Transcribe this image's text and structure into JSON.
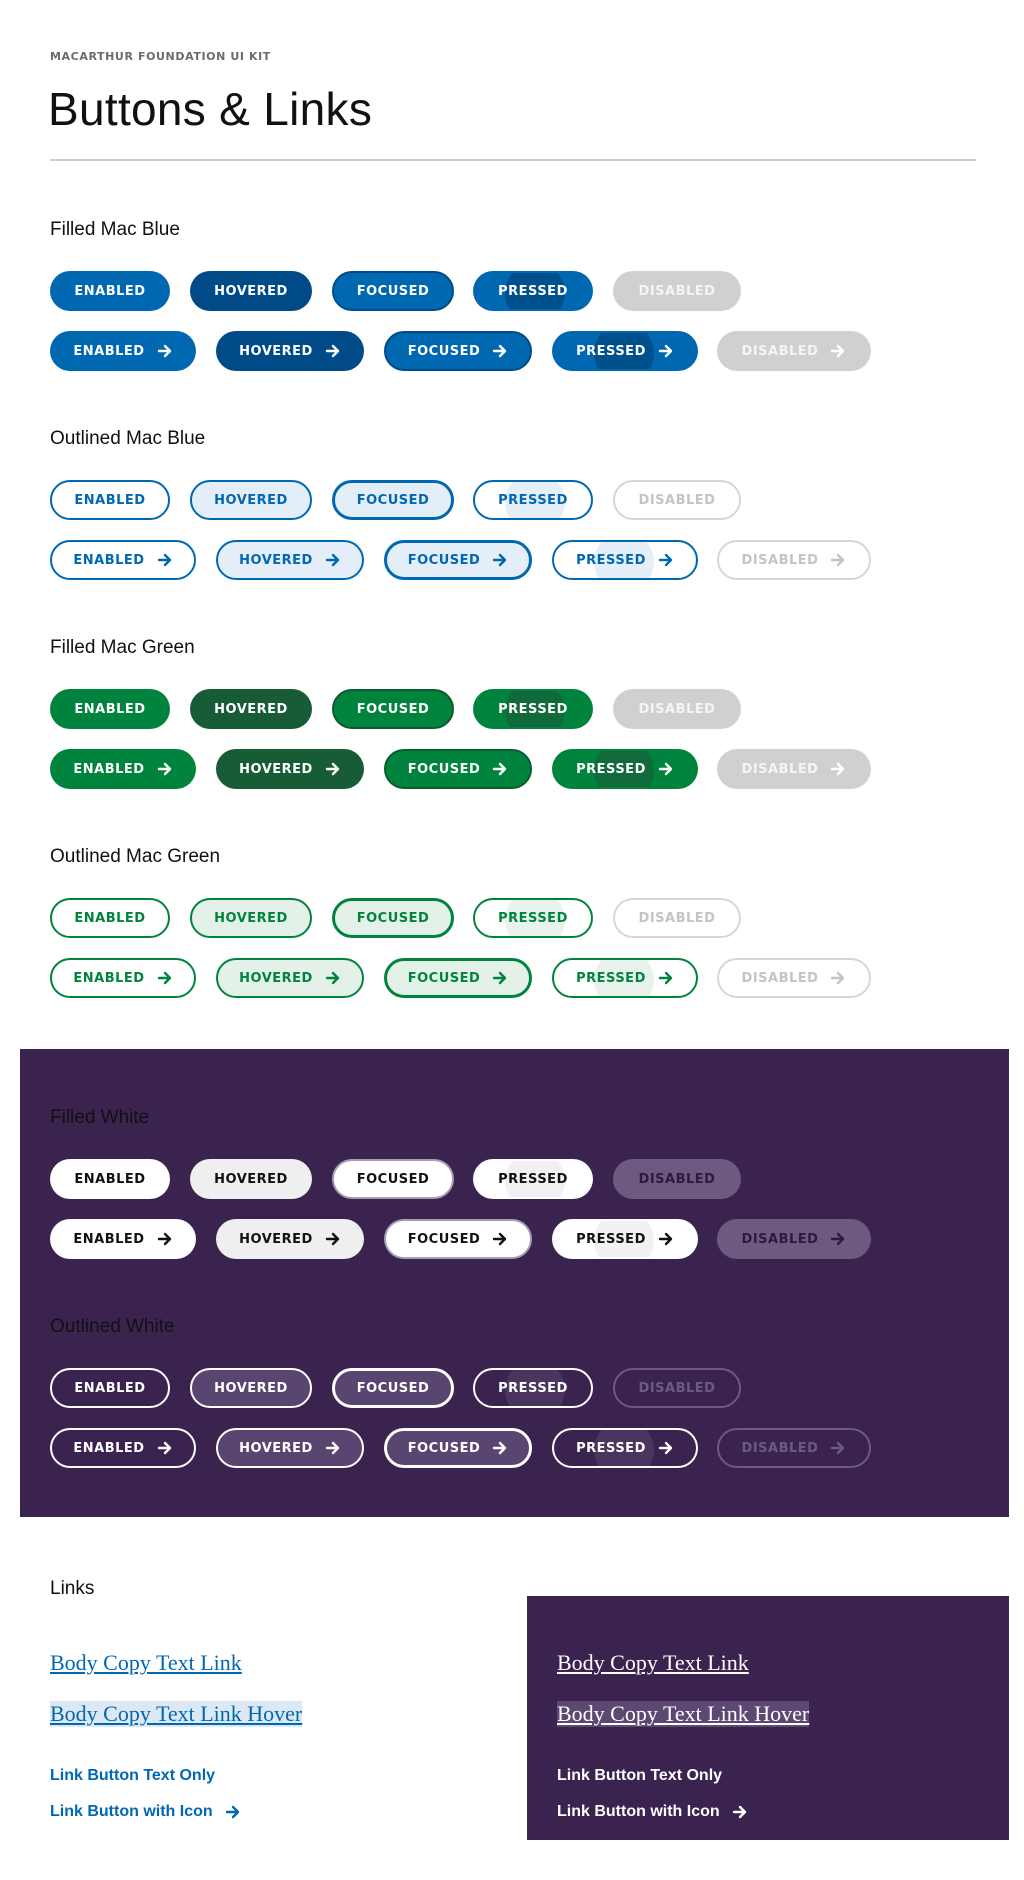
{
  "header": {
    "kit_label": "MACARTHUR FOUNDATION UI KIT",
    "title": "Buttons & Links"
  },
  "states": [
    "ENABLED",
    "HOVERED",
    "FOCUSED",
    "PRESSED",
    "DISABLED"
  ],
  "sections": [
    {
      "title": "Filled Mac Blue"
    },
    {
      "title": "Outlined Mac Blue"
    },
    {
      "title": "Filled Mac Green"
    },
    {
      "title": "Outlined Mac Green"
    },
    {
      "title": "Filled White"
    },
    {
      "title": "Outlined White"
    }
  ],
  "links": {
    "title": "Links",
    "body_link": "Body Copy Text Link",
    "body_link_hover": "Body Copy Text Link Hover",
    "link_button_text": "Link Button Text Only",
    "link_button_icon": "Link Button with Icon"
  },
  "colors": {
    "mac_blue": "#0067b1",
    "mac_blue_dark": "#004b87",
    "mac_green": "#00843d",
    "mac_green_dark": "#175c36",
    "purple": "#3a234f",
    "disabled_gray": "#d0d0d0"
  },
  "icons": {
    "arrow": "arrow-right-icon"
  }
}
